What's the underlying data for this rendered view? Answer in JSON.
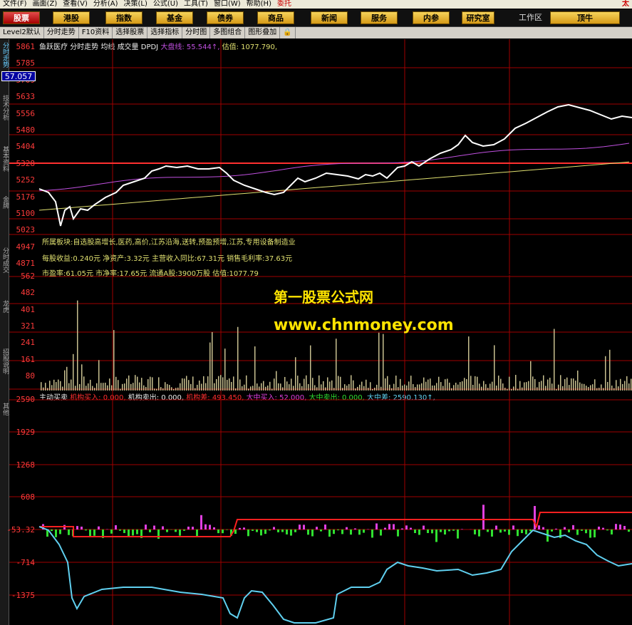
{
  "menu": [
    "文件(F)",
    "画面(Z)",
    "查看(V)",
    "分析(A)",
    "决策(L)",
    "公式(U)",
    "工具(T)",
    "窗口(W)",
    "帮助(H)",
    "委托"
  ],
  "menu_right": "太",
  "nav": {
    "tabs": [
      "股票",
      "港股",
      "指数",
      "基金",
      "债券",
      "商品",
      "新闻",
      "服务",
      "内参",
      "研究室"
    ],
    "workarea_label": "工作区",
    "top_button": "顶牛"
  },
  "toolbar": [
    "Level2默认",
    "分时走势",
    "F10资料",
    "选择股票",
    "选择指标",
    "分时图",
    "多图组合",
    "图形叠加"
  ],
  "sidebar": [
    "分时走势",
    "技术分析",
    "基本资料",
    "金牌",
    "分时成交",
    "龙虎",
    "招股说明",
    "其他"
  ],
  "price_panel": {
    "header": {
      "name": "鱼跃医疗",
      "view": "分时走势",
      "avg": "均线",
      "vol": "成交量",
      "ind": "DPDJ",
      "market_line": "大盘线: 55.544↑,",
      "valuation": "估值: 1077.790,"
    },
    "current_price": "57.057",
    "y_ticks": [
      "5861",
      "5785",
      "5709",
      "5633",
      "5556",
      "5480",
      "5404",
      "5328",
      "5252",
      "5176",
      "5100",
      "5023",
      "4947",
      "4871"
    ],
    "info_lines": [
      "所属板块:自选股高增长,医药,高价,江苏沿海,送转,预盈预增,江苏,专用设备制造业",
      "每股收益:0.240元   净资产:3.32元   主营收入同比:67.31元   销售毛利率:37.63元",
      "市盈率:61.05元   市净率:17.65元   流通A股:3900万股   估值:1077.79"
    ]
  },
  "volume_panel": {
    "y_ticks": [
      "562",
      "482",
      "401",
      "321",
      "241",
      "161",
      "80"
    ]
  },
  "flow_panel": {
    "header": {
      "title": "主动买卖",
      "inst_buy": "机构买入: 0.000,",
      "inst_sell": "机构卖出: 0.000,",
      "inst_diff": "机构差: 493.450,",
      "big_buy": "大中买入: 52.000,",
      "big_sell": "大中卖出: 0.000,",
      "big_diff": "大中差: 2590.130↑,"
    },
    "y_ticks": [
      "2590",
      "1929",
      "1268",
      "608",
      "-53.32",
      "-714",
      "-1375"
    ]
  },
  "watermark": {
    "line1": "第一股票公式网",
    "line2": "www.chnmoney.com"
  },
  "colors": {
    "grid": "#a00000",
    "price_line": "#ffffff",
    "avg_line": "#c050e0",
    "market_line": "#e0e070",
    "volume_bar": "#c8c090",
    "flow_pos": "#e040e0",
    "flow_neg": "#30e030",
    "flow_line_red": "#ff2020",
    "flow_line_cyan": "#60d0f0",
    "accent_yellow": "#ffe400"
  }
}
